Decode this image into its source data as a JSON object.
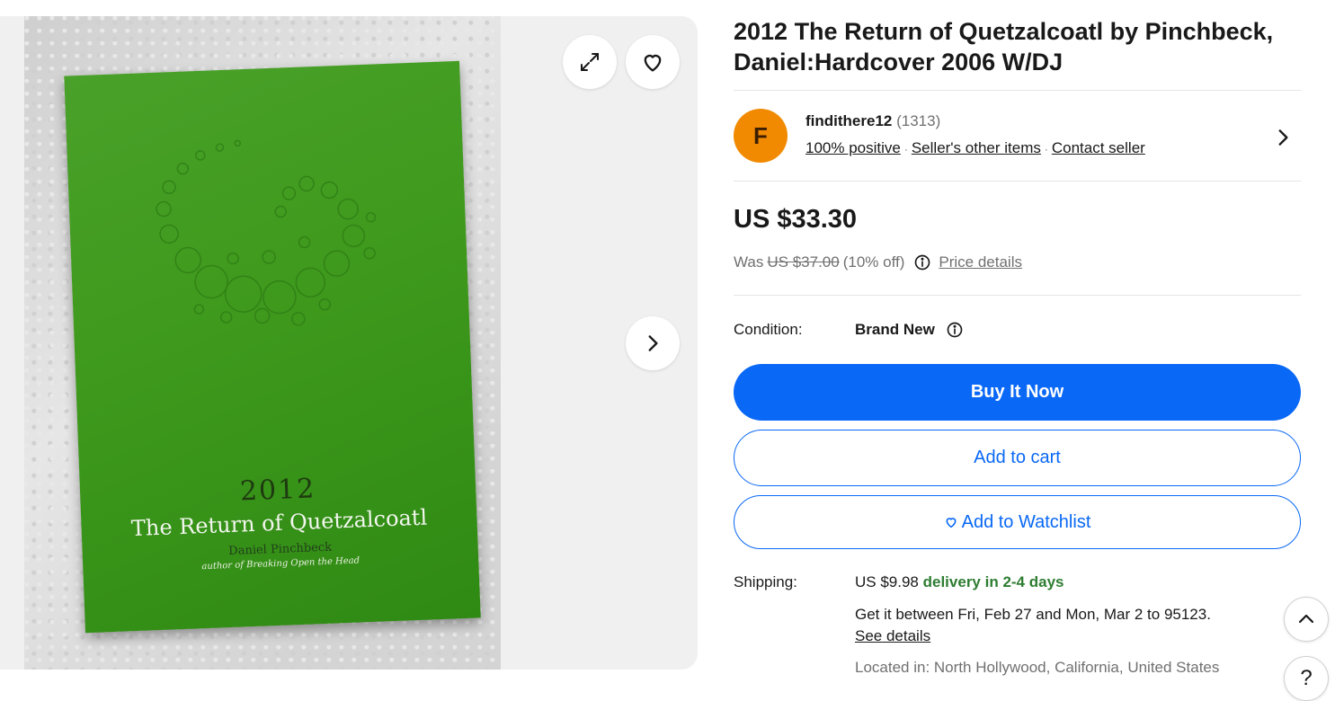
{
  "listing": {
    "title": "2012 The Return of Quetzalcoatl by Pinchbeck, Daniel:Hardcover 2006 W/DJ"
  },
  "image": {
    "cover_year": "2012",
    "cover_title": "The Return of Quetzalcoatl",
    "cover_author": "Daniel Pinchbeck",
    "cover_subtitle": "author of Breaking Open the Head",
    "cover_color": "#3f9a1d"
  },
  "gallery_controls": {
    "expand_icon": "expand-icon",
    "favorite_icon": "heart-icon",
    "next_icon": "chevron-right-icon"
  },
  "seller": {
    "avatar_letter": "F",
    "avatar_color": "#f18a00",
    "name": "findithere12",
    "feedback_count": "(1313)",
    "positive": "100% positive",
    "other_items": "Seller's other items",
    "contact": "Contact seller"
  },
  "price": {
    "current": "US $33.30",
    "was_label": "Was",
    "was_price": "US $37.00",
    "discount": "(10% off)",
    "details_link": "Price details"
  },
  "condition": {
    "label": "Condition:",
    "value": "Brand New"
  },
  "actions": {
    "buy_now": "Buy It Now",
    "add_to_cart": "Add to cart",
    "watchlist": "Add to Watchlist",
    "accent_color": "#0968f6"
  },
  "shipping": {
    "label": "Shipping:",
    "cost": "US $9.98",
    "delivery": "delivery in 2-4 days",
    "estimate": "Get it between Fri, Feb 27 and Mon, Mar 2 to 95123.",
    "see_details": "See details",
    "located": "Located in: North Hollywood, California, United States"
  },
  "floating": {
    "scroll_top_icon": "chevron-up-icon",
    "help_label": "?"
  }
}
